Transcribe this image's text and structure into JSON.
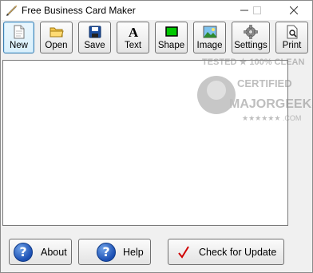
{
  "window": {
    "title": "Free Business Card Maker"
  },
  "toolbar": {
    "buttons": [
      {
        "label": "New",
        "icon": "new-document-icon"
      },
      {
        "label": "Open",
        "icon": "folder-icon"
      },
      {
        "label": "Save",
        "icon": "floppy-disk-icon"
      },
      {
        "label": "Text",
        "icon": "text-a-icon"
      },
      {
        "label": "Shape",
        "icon": "rectangle-shape-icon"
      },
      {
        "label": "Image",
        "icon": "picture-icon"
      },
      {
        "label": "Settings",
        "icon": "gear-icon"
      },
      {
        "label": "Print",
        "icon": "print-preview-icon"
      }
    ]
  },
  "watermark": {
    "line1": "TESTED ★ 100% CLEAN",
    "line2": "CERTIFIED",
    "line3": "MAJORGEEKS",
    "line4": "★★★★★★ .COM"
  },
  "footer": {
    "about_label": "About",
    "help_label": "Help",
    "update_label": "Check for Update"
  },
  "colors": {
    "active_border": "#3c7fb1",
    "shape_icon_fill": "#00c800",
    "check_mark": "#d00000",
    "help_icon": "#1b4fb3"
  }
}
